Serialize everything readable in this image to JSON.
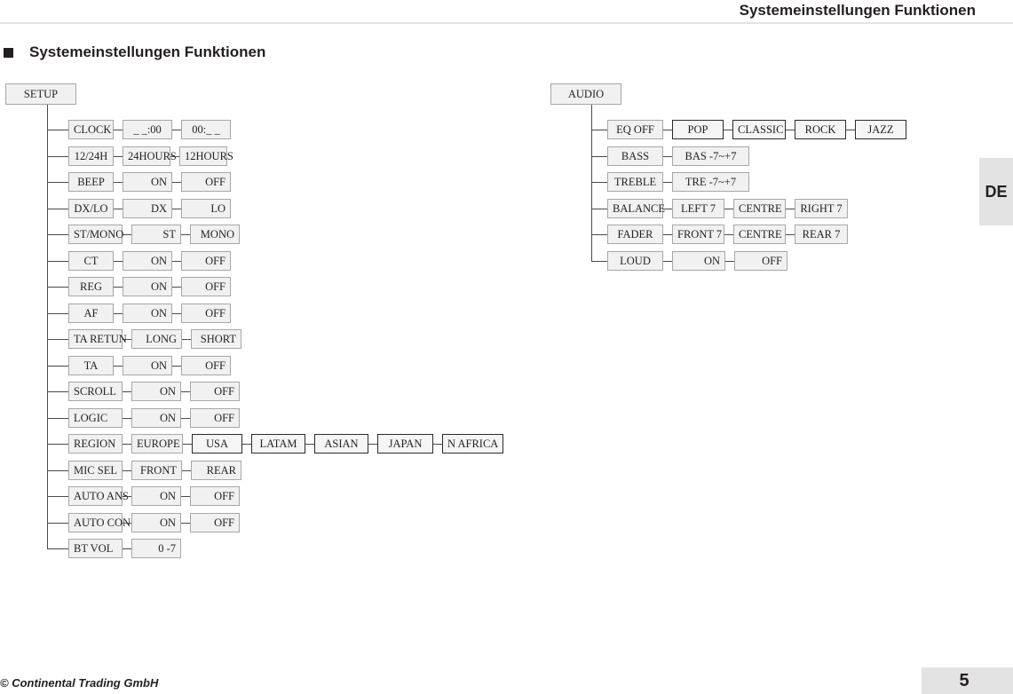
{
  "header": {
    "title": "Systemeinstellungen Funktionen"
  },
  "section": {
    "heading": "Systemeinstellungen Funktionen",
    "bullet_icon": "square-bullet-icon"
  },
  "language_tab": {
    "label": "DE"
  },
  "footer": {
    "copyright": "© Continental Trading GmbH",
    "page_number": "5"
  },
  "colors": {
    "node_fill": "#f1f1f1",
    "node_border": "#a7a7a7",
    "node_border_strong": "#2b2b2b",
    "line": "#4a4a4a",
    "accent_gray": "#e3e3e3",
    "text": "#231f20"
  },
  "setup_tree": {
    "root": "SETUP",
    "rows": [
      {
        "label": "CLOCK",
        "options": [
          "_ _:00",
          "00:_ _"
        ]
      },
      {
        "label": "12/24H",
        "options": [
          "24HOURS",
          "12HOURS"
        ]
      },
      {
        "label": "BEEP",
        "options": [
          "ON",
          "OFF"
        ]
      },
      {
        "label": "DX/LO",
        "options": [
          "DX",
          "LO"
        ]
      },
      {
        "label": "ST/MONO",
        "options": [
          "ST",
          "MONO"
        ]
      },
      {
        "label": "CT",
        "options": [
          "ON",
          "OFF"
        ]
      },
      {
        "label": "REG",
        "options": [
          "ON",
          "OFF"
        ]
      },
      {
        "label": "AF",
        "options": [
          "ON",
          "OFF"
        ]
      },
      {
        "label": "TA RETUN",
        "options": [
          "LONG",
          "SHORT"
        ]
      },
      {
        "label": "TA",
        "options": [
          "ON",
          "OFF"
        ]
      },
      {
        "label": "SCROLL",
        "options": [
          "ON",
          "OFF"
        ]
      },
      {
        "label": "LOGIC",
        "options": [
          "ON",
          "OFF"
        ]
      },
      {
        "label": "REGION",
        "options": [
          "EUROPE",
          "USA",
          "LATAM",
          "ASIAN",
          "JAPAN",
          "N AFRICA"
        ]
      },
      {
        "label": "MIC SEL",
        "options": [
          "FRONT",
          "REAR"
        ]
      },
      {
        "label": "AUTO ANS",
        "options": [
          "ON",
          "OFF"
        ]
      },
      {
        "label": "AUTO CON",
        "options": [
          "ON",
          "OFF"
        ]
      },
      {
        "label": "BT VOL",
        "options": [
          "0 -7"
        ]
      }
    ]
  },
  "audio_tree": {
    "root": "AUDIO",
    "rows": [
      {
        "label": "EQ OFF",
        "options": [
          "POP",
          "CLASSIC",
          "ROCK",
          "JAZZ"
        ]
      },
      {
        "label": "BASS",
        "options": [
          "BAS -7~+7"
        ]
      },
      {
        "label": "TREBLE",
        "options": [
          "TRE -7~+7"
        ]
      },
      {
        "label": "BALANCE",
        "options": [
          "LEFT 7",
          "CENTRE",
          "RIGHT 7"
        ]
      },
      {
        "label": "FADER",
        "options": [
          "FRONT 7",
          "CENTRE",
          "REAR 7"
        ]
      },
      {
        "label": "LOUD",
        "options": [
          "ON",
          "OFF"
        ]
      }
    ]
  }
}
